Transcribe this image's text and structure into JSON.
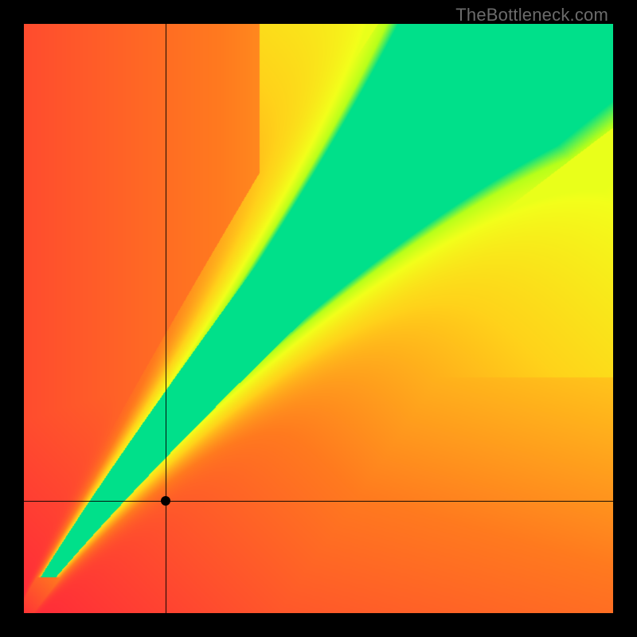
{
  "watermark": "TheBottleneck.com",
  "chart_data": {
    "type": "heatmap",
    "title": "",
    "xlabel": "",
    "ylabel": "",
    "xlim": [
      0,
      100
    ],
    "ylim": [
      0,
      100
    ],
    "crosshair": {
      "x": 24,
      "y": 19
    },
    "marker": {
      "x": 24,
      "y": 19
    },
    "diagonal_band": {
      "description": "Optimal-match ridge running from origin to top-right; green along ridge, fading through yellow/orange to red away from it.",
      "slope_estimate": 1.18,
      "band_width_estimate_pct": 10
    },
    "color_stops": [
      {
        "t": 0.0,
        "color": "#ff2a3a"
      },
      {
        "t": 0.35,
        "color": "#ff7a1f"
      },
      {
        "t": 0.6,
        "color": "#ffd31a"
      },
      {
        "t": 0.8,
        "color": "#f3ff1a"
      },
      {
        "t": 0.92,
        "color": "#b7ff1a"
      },
      {
        "t": 1.0,
        "color": "#00e08a"
      }
    ]
  }
}
